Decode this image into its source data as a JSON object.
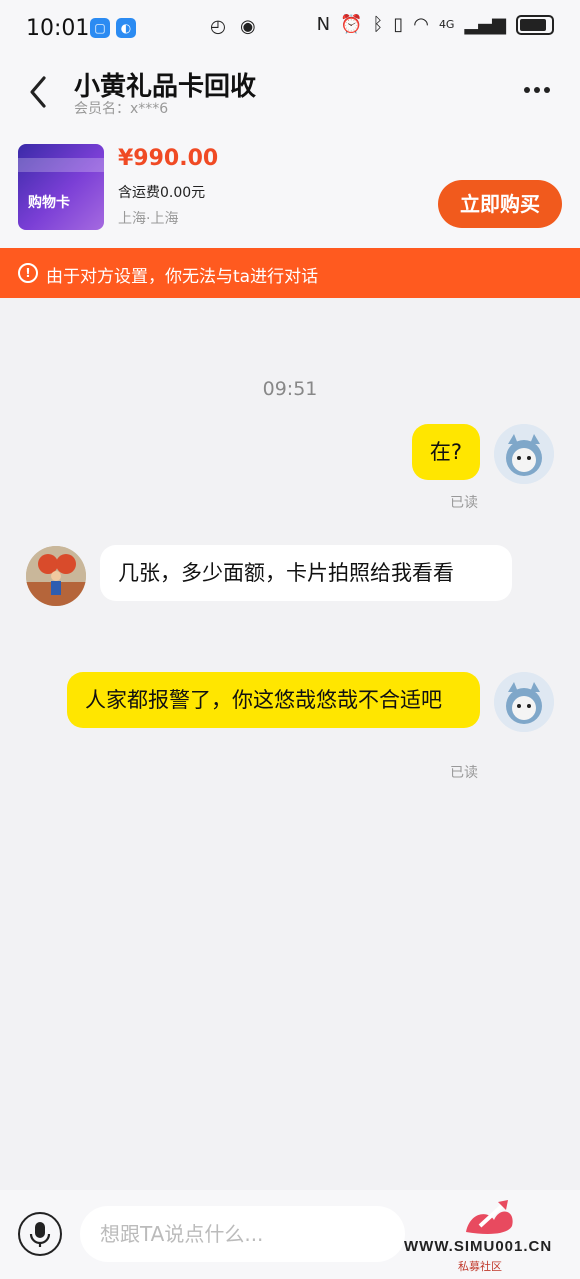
{
  "status_bar": {
    "time": "10:01",
    "network": "4G"
  },
  "header": {
    "title": "小黄礼品卡回收",
    "member": "会员名：x***6"
  },
  "product": {
    "price": "¥990.00",
    "shipping": "含运费0.00元",
    "location": "上海·上海",
    "buy_label": "立即购买",
    "thumb_text": "购物卡"
  },
  "notice": {
    "text": "由于对方设置，你无法与ta进行对话"
  },
  "chat": {
    "timestamp": "09:51",
    "messages": [
      {
        "from": "me",
        "text": "在?",
        "status": "已读"
      },
      {
        "from": "other",
        "text": "几张，多少面额，卡片拍照给我看看"
      },
      {
        "from": "me",
        "text": "人家都报警了，你这悠哉悠哉不合适吧",
        "status": "已读"
      }
    ]
  },
  "input": {
    "placeholder": "想跟TA说点什么..."
  },
  "watermark": {
    "site": "WWW.SIMU001.CN",
    "sub": "私募社区"
  },
  "colors": {
    "accent": "#f15a1d",
    "notice": "#ff5a1f",
    "my_bubble": "#ffe600"
  }
}
